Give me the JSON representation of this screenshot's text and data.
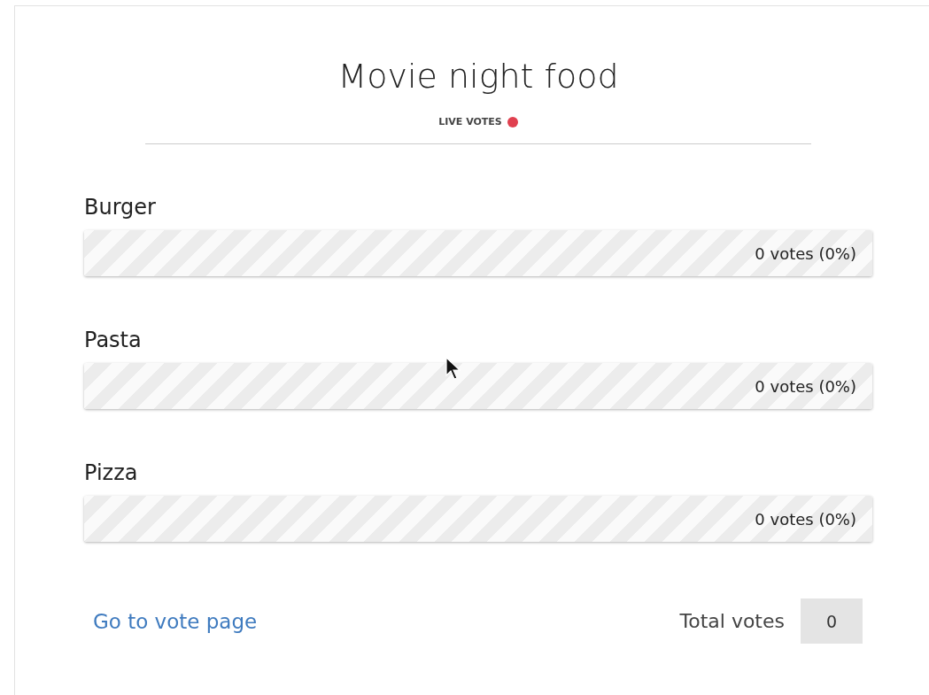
{
  "title": "Movie night food",
  "live": {
    "label": "LIVE VOTES",
    "color": "#e0404f"
  },
  "options": [
    {
      "name": "Burger",
      "reading": "0 votes (0%)"
    },
    {
      "name": "Pasta",
      "reading": "0 votes (0%)"
    },
    {
      "name": "Pizza",
      "reading": "0 votes (0%)"
    }
  ],
  "footer": {
    "link": "Go to vote page",
    "total_label": "Total votes",
    "total": "0"
  }
}
